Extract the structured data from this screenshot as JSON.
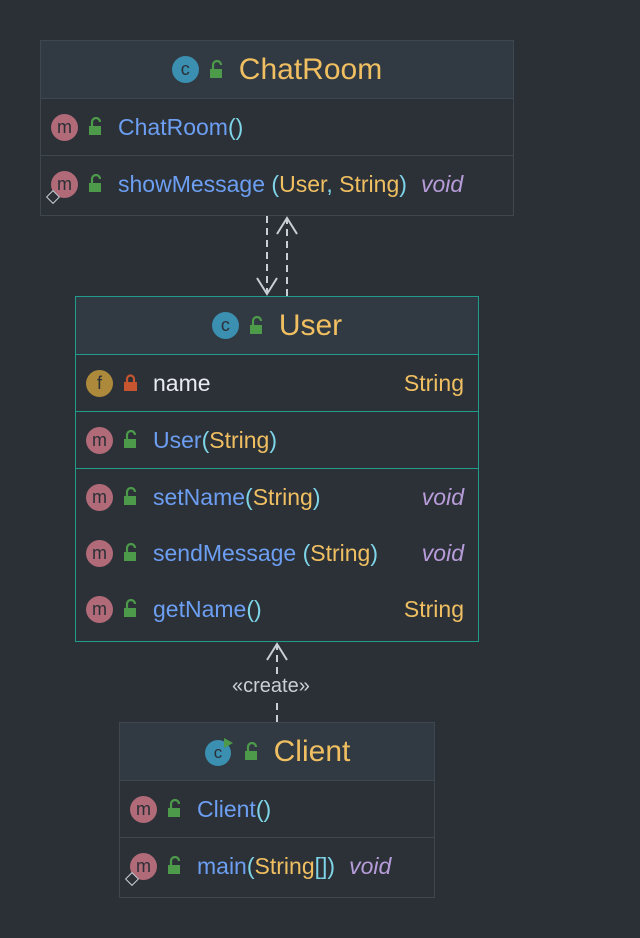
{
  "colors": {
    "background": "#2b2f36",
    "class_name": "#f0bf61",
    "method_name": "#6c9ef2",
    "field_name": "#e8ecf0",
    "type": "#f0bf61",
    "void_type": "#b79cd9",
    "selected_border": "#1f9c8c"
  },
  "chatroom": {
    "title": "ChatRoom",
    "ctor": {
      "name": "ChatRoom",
      "open": "(",
      "close": ")"
    },
    "show": {
      "name": "showMessage",
      "open": "(",
      "p1": "User",
      "sep": ", ",
      "p2": "String",
      "close": ")",
      "ret": "void"
    }
  },
  "user": {
    "title": "User",
    "field": {
      "name": "name",
      "type": "String"
    },
    "ctor": {
      "name": "User",
      "open": "(",
      "param": "String",
      "close": ")"
    },
    "set": {
      "name": "setName",
      "open": "(",
      "param": "String",
      "close": ")",
      "ret": "void"
    },
    "send": {
      "name": "sendMessage",
      "open": "(",
      "param": "String",
      "close": ")",
      "ret": "void"
    },
    "get": {
      "name": "getName",
      "open": "(",
      "close": ")",
      "ret": "String"
    }
  },
  "client": {
    "title": "Client",
    "ctor": {
      "name": "Client",
      "open": "(",
      "close": ")"
    },
    "main": {
      "name": "main",
      "open": "(",
      "param": "String",
      "arr": "[]",
      "close": ")",
      "ret": "void"
    }
  },
  "relations": {
    "create_label": "«create»"
  },
  "icons": {
    "class_badge": "c",
    "method_badge": "m",
    "field_badge": "f",
    "main_class_badge": "run-class-icon",
    "public_visibility": "green-unlock-icon",
    "private_visibility": "red-lock-icon"
  }
}
